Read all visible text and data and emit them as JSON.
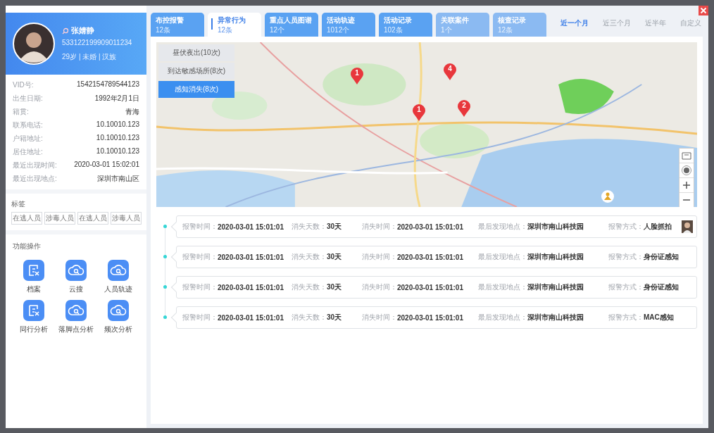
{
  "profile": {
    "name": "张婧静",
    "id_number": "533122199909011234",
    "meta": "29岁 | 未婚 | 汉族"
  },
  "info": [
    {
      "label": "VID号:",
      "value": "1542154789544123"
    },
    {
      "label": "出生日期:",
      "value": "1992年2月1日"
    },
    {
      "label": "籍贯:",
      "value": "青海"
    },
    {
      "label": "联系电话:",
      "value": "10.10010.123"
    },
    {
      "label": "户籍地址:",
      "value": "10.10010.123"
    },
    {
      "label": "居住地址:",
      "value": "10.10010.123"
    },
    {
      "label": "最近出现时间:",
      "value": "2020-03-01 15:02:01"
    },
    {
      "label": "最近出现地点:",
      "value": "深圳市南山区"
    }
  ],
  "tags": {
    "title": "标签",
    "items": [
      "在逃人员",
      "涉毒人员",
      "在逃人员",
      "涉毒人员"
    ]
  },
  "functions": {
    "title": "功能操作",
    "items": [
      {
        "label": "档案",
        "kind": "file"
      },
      {
        "label": "云搜",
        "kind": "cloud"
      },
      {
        "label": "人员轨迹",
        "kind": "cloud"
      },
      {
        "label": "同行分析",
        "kind": "file"
      },
      {
        "label": "落脚点分析",
        "kind": "cloud"
      },
      {
        "label": "频次分析",
        "kind": "cloud"
      }
    ]
  },
  "tabs": [
    {
      "title": "布控报警",
      "count": "12条",
      "selected": false,
      "disabled": false
    },
    {
      "title": "异常行为",
      "count": "12条",
      "selected": true,
      "disabled": false
    },
    {
      "title": "重点人员图谱",
      "count": "12个",
      "selected": false,
      "disabled": false
    },
    {
      "title": "活动轨迹",
      "count": "1012个",
      "selected": false,
      "disabled": false
    },
    {
      "title": "活动记录",
      "count": "102条",
      "selected": false,
      "disabled": false
    },
    {
      "title": "关联案件",
      "count": "1个",
      "selected": false,
      "disabled": true
    },
    {
      "title": "核查记录",
      "count": "12条",
      "selected": false,
      "disabled": true
    }
  ],
  "time_filters": [
    {
      "label": "近一个月",
      "selected": true
    },
    {
      "label": "近三个月",
      "selected": false
    },
    {
      "label": "近半年",
      "selected": false
    },
    {
      "label": "自定义",
      "selected": false
    }
  ],
  "map": {
    "filters": [
      {
        "label": "昼伏夜出(10次)",
        "selected": false
      },
      {
        "label": "到达敏感场所(8次)",
        "selected": false
      },
      {
        "label": "感知消失(8次)",
        "selected": true
      }
    ],
    "markers": [
      {
        "count": "1"
      },
      {
        "count": "4"
      },
      {
        "count": "1"
      },
      {
        "count": "2"
      }
    ]
  },
  "records": [
    {
      "has_photo": true,
      "fields": [
        {
          "label": "报警时间：",
          "value": "2020-03-01 15:01:01"
        },
        {
          "label": "消失天数：",
          "value": "30天"
        },
        {
          "label": "消失时间：",
          "value": "2020-03-01 15:01:01"
        },
        {
          "label": "最后发现地点：",
          "value": "深圳市南山科技园"
        },
        {
          "label": "报警方式：",
          "value": "人脸抓拍"
        }
      ]
    },
    {
      "has_photo": false,
      "fields": [
        {
          "label": "报警时间：",
          "value": "2020-03-01 15:01:01"
        },
        {
          "label": "消失天数：",
          "value": "30天"
        },
        {
          "label": "消失时间：",
          "value": "2020-03-01 15:01:01"
        },
        {
          "label": "最后发现地点：",
          "value": "深圳市南山科技园"
        },
        {
          "label": "报警方式：",
          "value": "身份证感知"
        }
      ]
    },
    {
      "has_photo": false,
      "fields": [
        {
          "label": "报警时间：",
          "value": "2020-03-01 15:01:01"
        },
        {
          "label": "消失天数：",
          "value": "30天"
        },
        {
          "label": "消失时间：",
          "value": "2020-03-01 15:01:01"
        },
        {
          "label": "最后发现地点：",
          "value": "深圳市南山科技园"
        },
        {
          "label": "报警方式：",
          "value": "身份证感知"
        }
      ]
    },
    {
      "has_photo": false,
      "fields": [
        {
          "label": "报警时间：",
          "value": "2020-03-01 15:01:01"
        },
        {
          "label": "消失天数：",
          "value": "30天"
        },
        {
          "label": "消失时间：",
          "value": "2020-03-01 15:01:01"
        },
        {
          "label": "最后发现地点：",
          "value": "深圳市南山科技园"
        },
        {
          "label": "报警方式：",
          "value": "MAC感知"
        }
      ]
    }
  ]
}
